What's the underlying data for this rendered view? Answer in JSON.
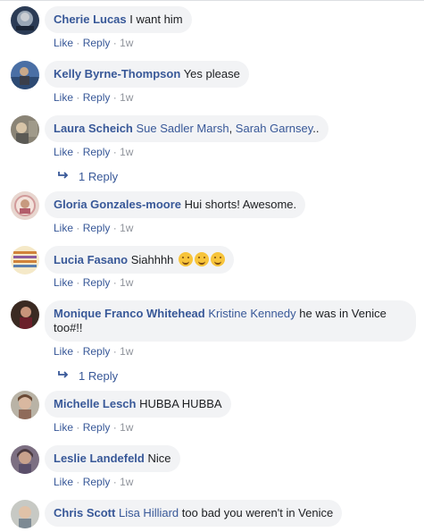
{
  "actions": {
    "like": "Like",
    "reply": "Reply",
    "sep": "·",
    "time": "1w"
  },
  "comments": [
    {
      "author": "Cherie Lucas",
      "text": "I want him"
    },
    {
      "author": "Kelly Byrne-Thompson",
      "text": "Yes please"
    },
    {
      "author": "Laura Scheich",
      "mention1": "Sue Sadler Marsh",
      "sep": ", ",
      "mention2": "Sarah Garnsey",
      "text": "..",
      "replies": "1 Reply"
    },
    {
      "author": "Gloria Gonzales-moore",
      "text": "Hui shorts! Awesome."
    },
    {
      "author": "Lucia Fasano",
      "text": "Siahhhh"
    },
    {
      "author": "Monique Franco Whitehead",
      "mention1": "Kristine Kennedy",
      "text": " he was in Venice too#!!",
      "replies": "1 Reply"
    },
    {
      "author": "Michelle Lesch",
      "text": "HUBBA HUBBA"
    },
    {
      "author": "Leslie Landefeld",
      "text": "Nice"
    },
    {
      "author": "Chris Scott",
      "mention1": "Lisa Hilliard",
      "text": " too bad you weren't in Venice"
    }
  ],
  "icons": {
    "reply_arrow": "reply-arrow-icon",
    "emoji": "grinning-face-icon"
  },
  "colors": {
    "link": "#385898",
    "bubble": "#f2f3f5",
    "meta": "#90949c"
  }
}
